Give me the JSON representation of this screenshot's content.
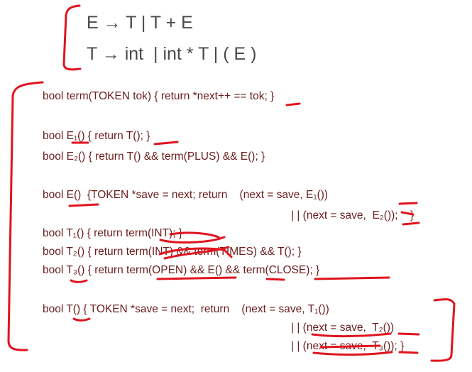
{
  "grammar": {
    "rule_e": "E → T | T + E",
    "rule_t": "T → int  | int * T | ( E )"
  },
  "code": {
    "line_term": "bool term(TOKEN tok) { return *next++ == tok; }",
    "line_e1": "bool E₁() { return T(); }",
    "line_e2": "bool E₂() { return T() && term(PLUS) && E(); }",
    "line_e_a": "bool E()  {TOKEN *save = next; return    (next = save, E₁())",
    "line_e_b": "| | (next = save,  E₂());    }",
    "line_t1": "bool T₁() { return term(INT); }",
    "line_t2": "bool T₂() { return term(INT) && term(TIMES) && T(); }",
    "line_t3": "bool T₃() { return term(OPEN) && E() && term(CLOSE); }",
    "line_t_a": "bool T() { TOKEN *save = next;  return    (next = save, T₁())",
    "line_t_b": "| | (next = save,  T₂())",
    "line_t_c": "| | (next = save,  T₃()); }"
  },
  "colors": {
    "ink": "#e0141e",
    "code_text": "#6b1d1d",
    "grammar_text": "#4a4a4a"
  }
}
